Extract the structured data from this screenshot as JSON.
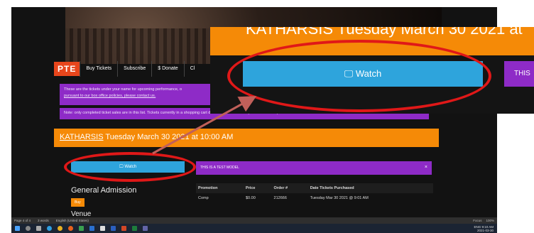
{
  "nav": {
    "logo": "PTE",
    "items": [
      "Buy Tickets",
      "Subscribe",
      "$ Donate",
      "Cl"
    ]
  },
  "info": {
    "line1": "These are the tickets under your name for upcoming performance, o",
    "line2": "pursuant to our box office policies, please contact us.",
    "note": "Note: only completed ticket sales are in this list. Tickets currently in a shopping cart do not appear until the purchase is completed."
  },
  "event": {
    "name": "KATHARSIS",
    "date_text": " Tuesday March 30 2021 at 10:00 AM"
  },
  "watch_label": "Watch",
  "test_model": {
    "text": "THIS IS A TEST MODEL",
    "close": "×"
  },
  "general_admission": "General Admission",
  "buy_label": "Buy",
  "venue": "Venue",
  "table": {
    "headers": [
      "Promotion",
      "Price",
      "Order #",
      "Date Tickets Purchased"
    ],
    "rows": [
      [
        "Comp",
        "$0.00",
        "212666",
        "Tuesday Mar 30 2021 @ 9:01 AM"
      ]
    ]
  },
  "zoom": {
    "title_partial": "KATHARSIS Tuesday March 30 2021 at",
    "watch_label": "Watch",
    "purple_partial": "THIS"
  },
  "statusbar": {
    "page": "Page 4 of 4",
    "words": "3 words",
    "language": "English (United States)",
    "focus": "Focus",
    "zoom": "100%"
  },
  "tray": {
    "lang": "ENG",
    "time": "9:10 AM",
    "date": "2021-03-30"
  },
  "colors": {
    "orange": "#f58a07",
    "blue": "#2ea4dc",
    "purple": "#8e2bc7",
    "red": "#e01818"
  }
}
